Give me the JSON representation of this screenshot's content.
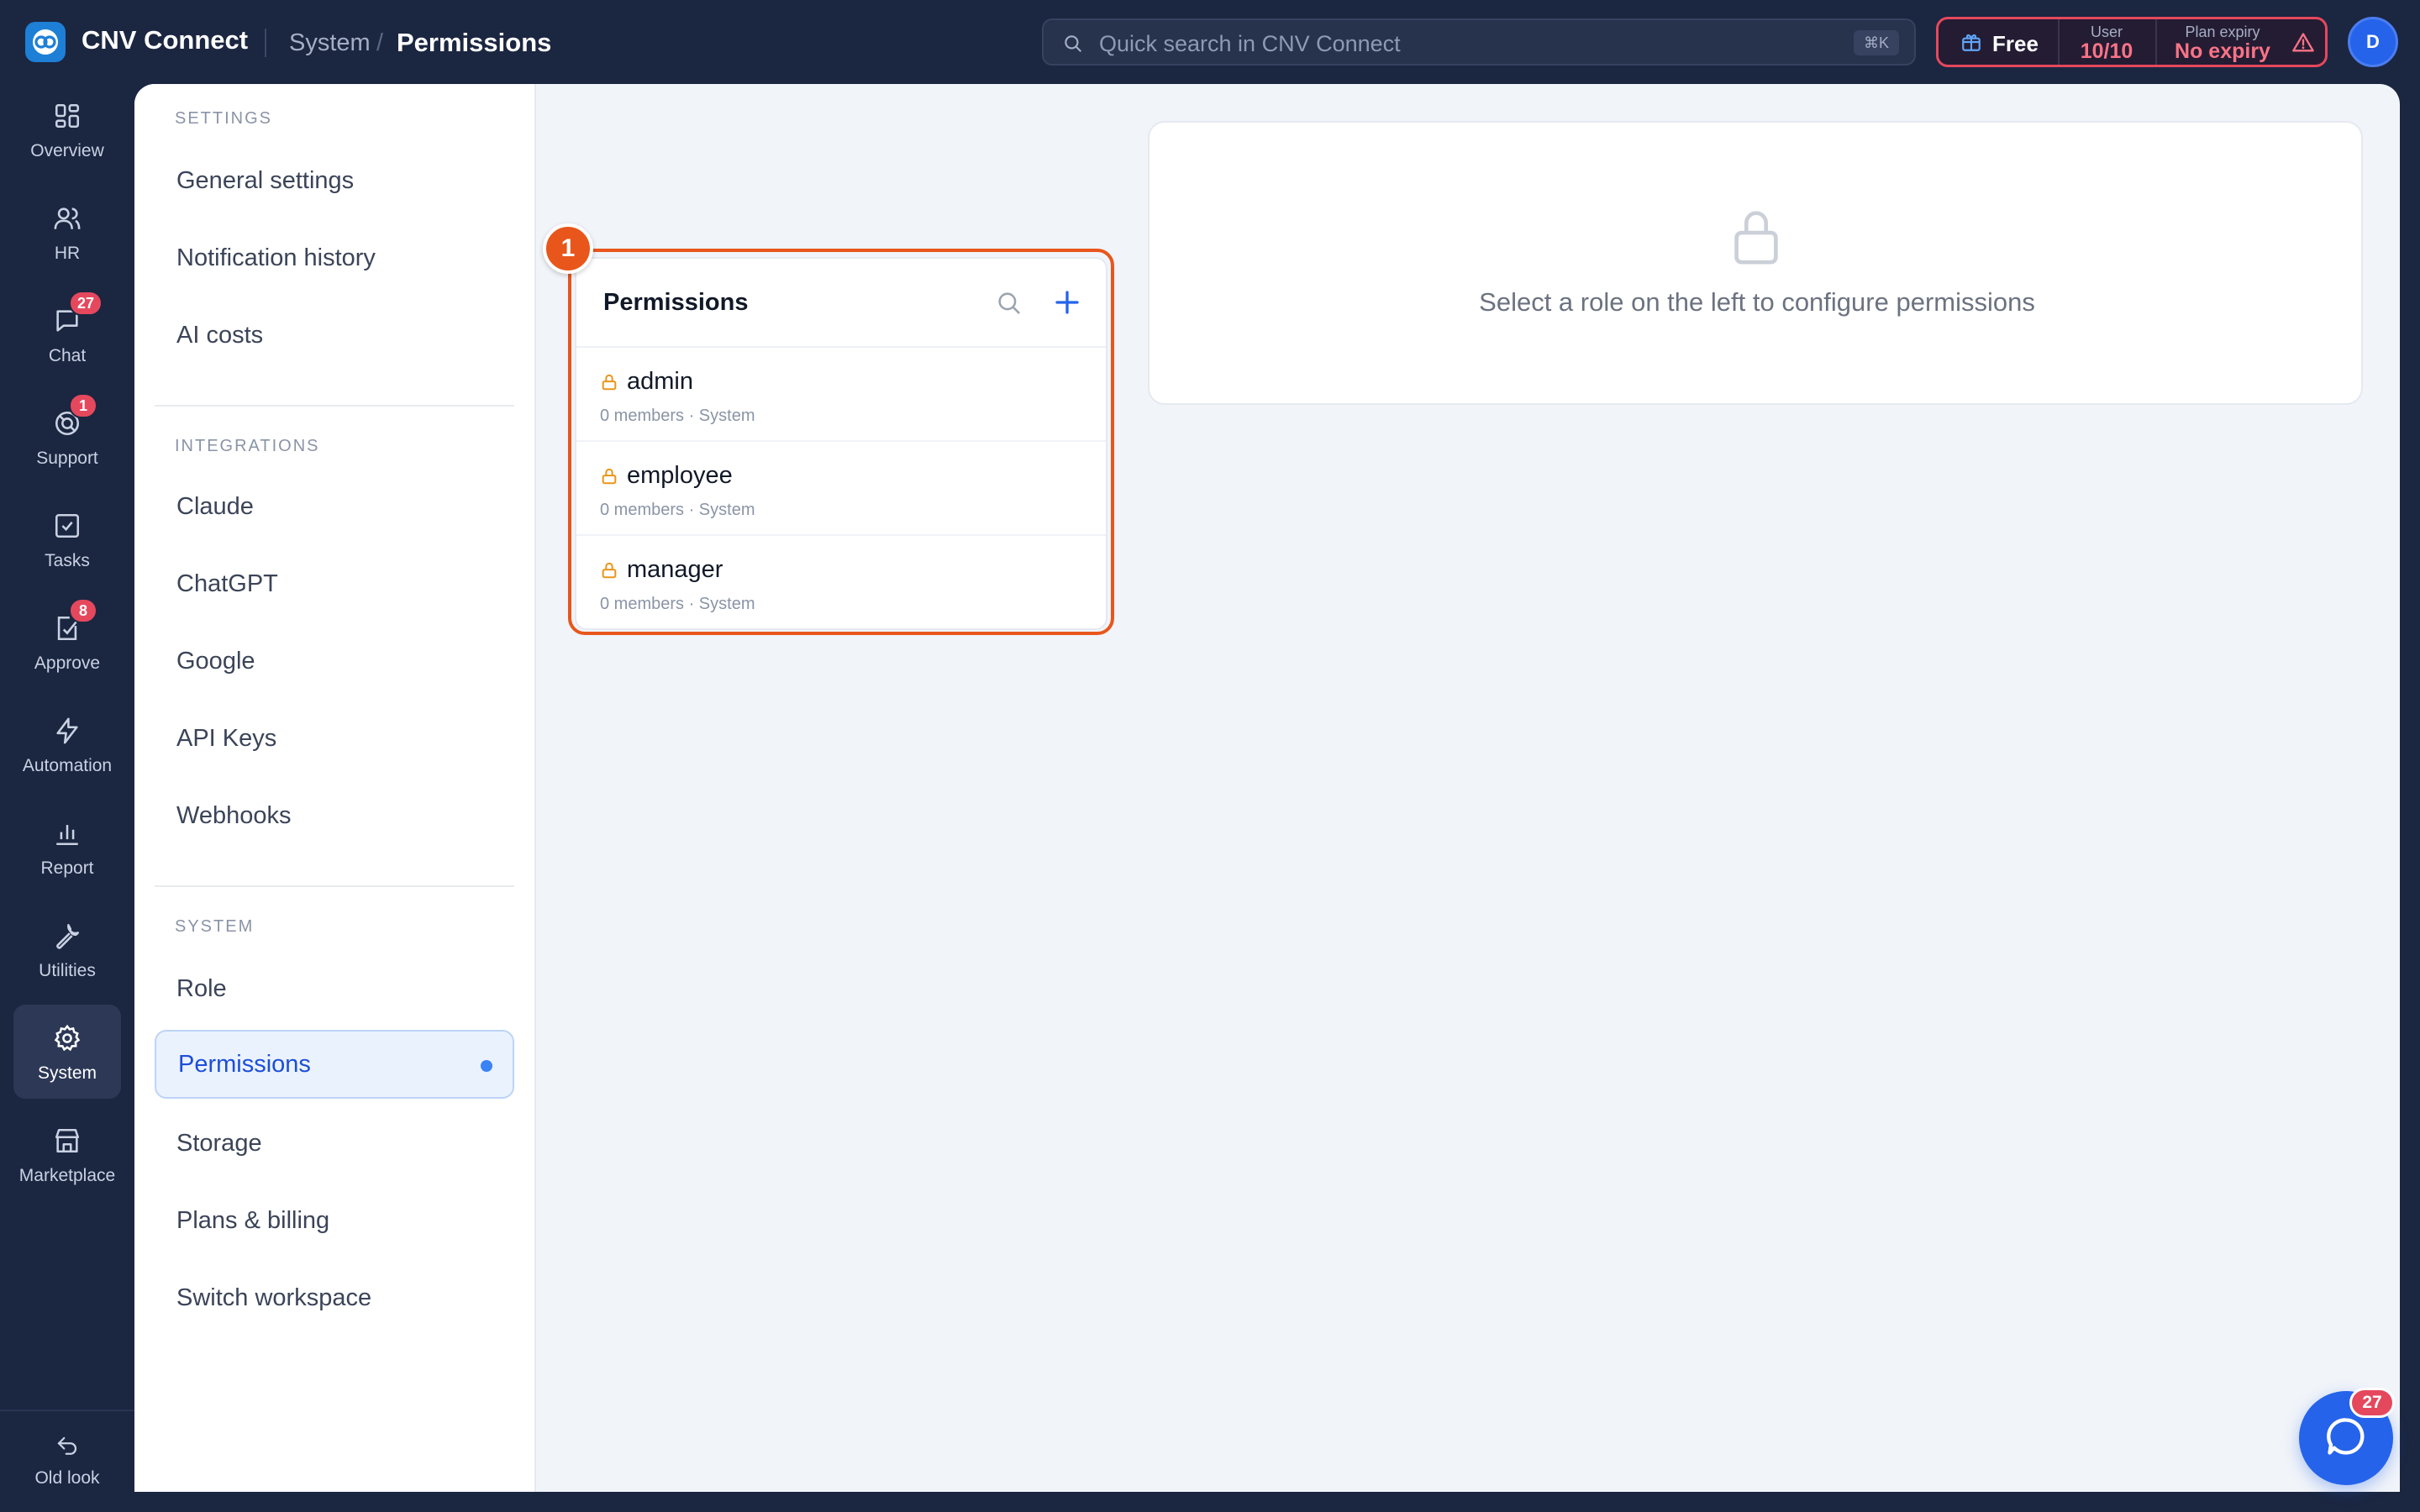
{
  "app": {
    "name": "CNV Connect"
  },
  "breadcrumb": {
    "parent": "System",
    "separator": "/",
    "current": "Permissions"
  },
  "search": {
    "placeholder": "Quick search in CNV Connect",
    "shortcut": "⌘K"
  },
  "plan": {
    "tier": "Free",
    "user_caption": "User",
    "user_value": "10/10",
    "expiry_caption": "Plan expiry",
    "expiry_value": "No expiry"
  },
  "avatar": {
    "initial": "D"
  },
  "rail": {
    "items": [
      {
        "label": "Overview",
        "icon": "grid-icon"
      },
      {
        "label": "HR",
        "icon": "users-icon"
      },
      {
        "label": "Chat",
        "icon": "chat-icon",
        "badge": "27"
      },
      {
        "label": "Support",
        "icon": "lifebuoy-icon",
        "badge": "1"
      },
      {
        "label": "Tasks",
        "icon": "checkbox-icon"
      },
      {
        "label": "Approve",
        "icon": "approve-icon",
        "badge": "8"
      },
      {
        "label": "Automation",
        "icon": "bolt-icon"
      },
      {
        "label": "Report",
        "icon": "bar-chart-icon"
      },
      {
        "label": "Utilities",
        "icon": "wrench-icon"
      },
      {
        "label": "System",
        "icon": "gear-icon",
        "active": true
      },
      {
        "label": "Marketplace",
        "icon": "store-icon"
      }
    ],
    "old_look": "Old look"
  },
  "settings": {
    "sections": [
      {
        "title": "SETTINGS",
        "items": [
          "General settings",
          "Notification history",
          "AI costs"
        ]
      },
      {
        "title": "INTEGRATIONS",
        "items": [
          "Claude",
          "ChatGPT",
          "Google",
          "API Keys",
          "Webhooks"
        ]
      },
      {
        "title": "SYSTEM",
        "items": [
          "Role",
          "Permissions",
          "Storage",
          "Plans & billing",
          "Switch workspace"
        ]
      }
    ],
    "active_item": "Permissions"
  },
  "permissions": {
    "title": "Permissions",
    "step": "1",
    "roles": [
      {
        "name": "admin",
        "meta": "0 members · System"
      },
      {
        "name": "employee",
        "meta": "0 members · System"
      },
      {
        "name": "manager",
        "meta": "0 members · System"
      }
    ]
  },
  "empty_state": {
    "text": "Select a role on the left to configure permissions"
  },
  "chat_fab": {
    "badge": "27"
  },
  "colors": {
    "accent": "#2563eb",
    "highlight": "#e8561b",
    "badge": "#e5485d",
    "sidebar_bg": "#1b2641"
  }
}
